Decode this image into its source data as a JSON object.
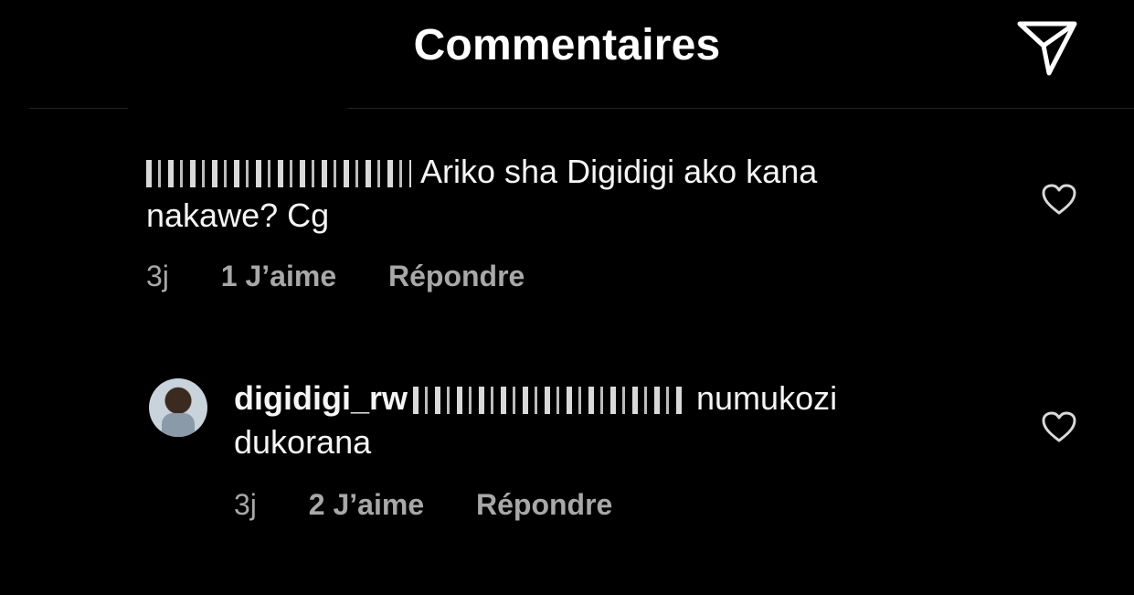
{
  "header": {
    "title": "Commentaires",
    "share_icon": "paper-plane-icon"
  },
  "comments": [
    {
      "text_line1": "Ariko sha Digidigi ako kana",
      "text_line2": "nakawe? Cg",
      "time": "3j",
      "likes": "1 J’aime",
      "reply": "Répondre",
      "icon": "heart-icon"
    },
    {
      "username": "digidigi_rw",
      "text_line1": "numukozi",
      "text_line2": "dukorana",
      "time": "3j",
      "likes": "2 J’aime",
      "reply": "Répondre",
      "icon": "heart-icon"
    }
  ]
}
